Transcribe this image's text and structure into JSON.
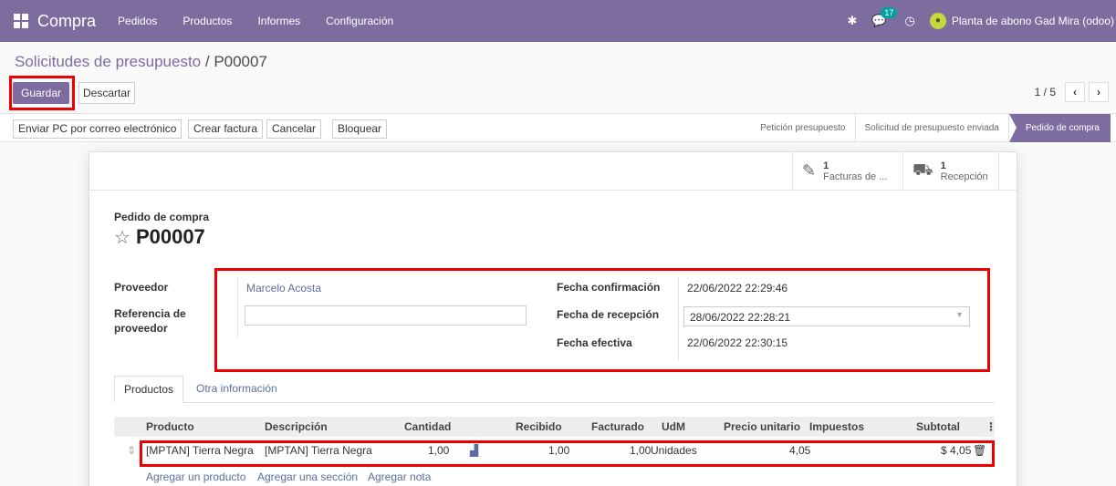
{
  "navbar": {
    "app_name": "Compra",
    "menu": [
      "Pedidos",
      "Productos",
      "Informes",
      "Configuración"
    ],
    "messages_count": "17",
    "company": "Planta de abono Gad Mira (odoo)"
  },
  "breadcrumb": {
    "parent": "Solicitudes de presupuesto",
    "separator": " / ",
    "current": "P00007"
  },
  "controls": {
    "save_label": "Guardar",
    "discard_label": "Descartar",
    "pager": "1 / 5"
  },
  "statusbar": {
    "buttons": [
      "Enviar PC por correo electrónico",
      "Crear factura",
      "Cancelar",
      "Bloquear"
    ],
    "stages": [
      "Petición presupuesto",
      "Solicitud de presupuesto enviada",
      "Pedido de compra"
    ],
    "active_stage": "Pedido de compra"
  },
  "smart_buttons": {
    "invoices_count": "1",
    "invoices_label": "Facturas de ...",
    "receipts_count": "1",
    "receipts_label": "Recepción"
  },
  "form": {
    "doc_type": "Pedido de compra",
    "name": "P00007",
    "vendor_label": "Proveedor",
    "vendor_value": "Marcelo Acosta",
    "vendor_ref_label": "Referencia de proveedor",
    "vendor_ref_value": "",
    "confirm_date_label": "Fecha confirmación",
    "confirm_date_value": "22/06/2022 22:29:46",
    "receipt_date_label": "Fecha de recepción",
    "receipt_date_value": "28/06/2022 22:28:21",
    "effective_date_label": "Fecha efectiva",
    "effective_date_value": "22/06/2022 22:30:15"
  },
  "tabs": [
    "Productos",
    "Otra información"
  ],
  "table": {
    "headers": [
      "Producto",
      "Descripción",
      "Cantidad",
      "Recibido",
      "Facturado",
      "UdM",
      "Precio unitario",
      "Impuestos",
      "Subtotal"
    ],
    "rows": [
      {
        "product": "[MPTAN] Tierra Negra",
        "description": "[MPTAN] Tierra Negra",
        "quantity": "1,00",
        "received": "1,00",
        "invoiced": "1,00",
        "uom": "Unidades",
        "unit_price": "4,05",
        "taxes": "",
        "subtotal": "$ 4,05"
      }
    ],
    "add_product": "Agregar un producto",
    "add_section": "Agregar una sección",
    "add_note": "Agregar nota"
  },
  "colors": {
    "brand": "#7c6d9e",
    "highlight": "#ee0000",
    "link": "#5a6f9e"
  }
}
